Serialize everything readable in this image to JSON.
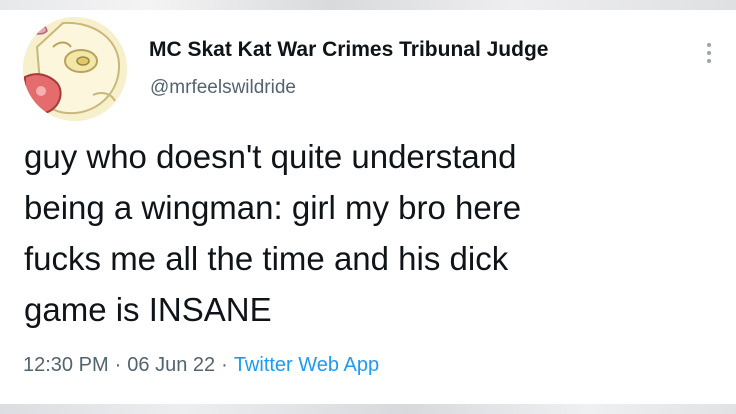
{
  "tweet": {
    "author": {
      "display_name": "MC Skat Kat War Crimes Tribunal Judge",
      "handle": "@mrfeelswildride",
      "avatar_icon": "cartoon-avatar"
    },
    "more_icon": "more-vertical-icon",
    "text_lines": [
      "guy who doesn't quite understand",
      "being a wingman: girl my bro here",
      "fucks me all the time and his dick",
      "game is INSANE"
    ],
    "meta": {
      "time": "12:30 PM",
      "separator": "·",
      "date": "06 Jun 22",
      "source": "Twitter Web App"
    },
    "colors": {
      "text": "#0f1419",
      "secondary": "#536471",
      "link": "#1d9bf0"
    }
  }
}
